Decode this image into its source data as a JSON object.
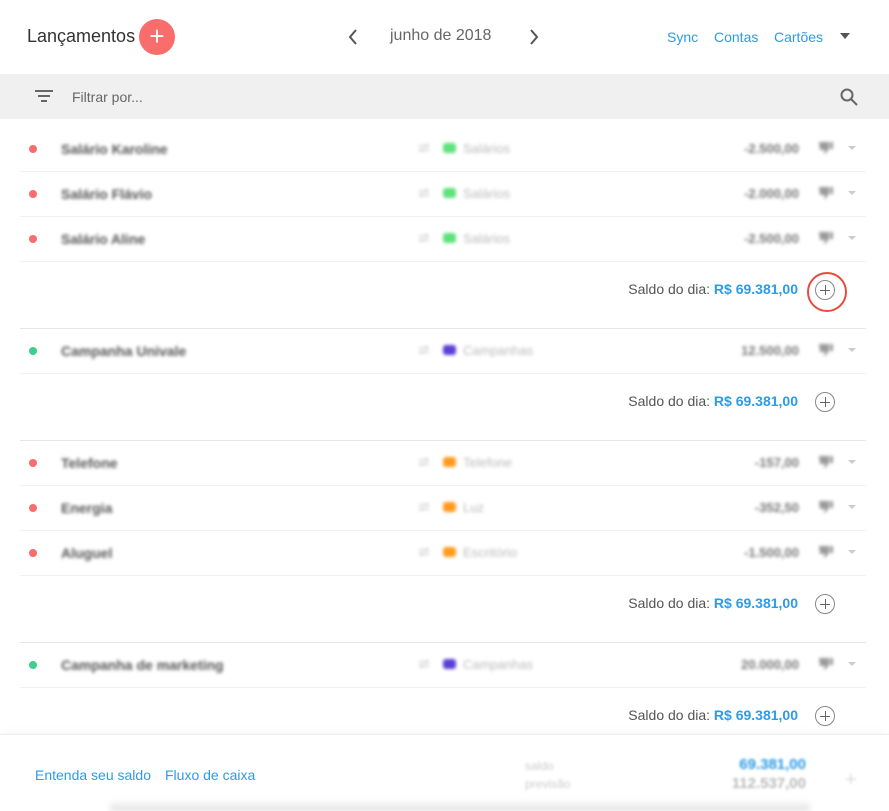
{
  "header": {
    "title": "Lançamentos",
    "add_label": "+",
    "month": "junho de 2018",
    "links": {
      "sync": "Sync",
      "contas": "Contas",
      "cartoes": "Cartões"
    }
  },
  "filter": {
    "placeholder": "Filtrar por..."
  },
  "groups": [
    {
      "items": [
        {
          "name": "Salário Karoline",
          "category": "Salários",
          "category_color": "#5ee27a",
          "value": "-2.500,00",
          "status_color": "#f96d6d"
        },
        {
          "name": "Salário Flávio",
          "category": "Salários",
          "category_color": "#5ee27a",
          "value": "-2.000,00",
          "status_color": "#f96d6d"
        },
        {
          "name": "Salário Aline",
          "category": "Salários",
          "category_color": "#5ee27a",
          "value": "-2.500,00",
          "status_color": "#f96d6d"
        }
      ],
      "saldo_label": "Saldo do dia:",
      "saldo_value": "R$ 69.381,00"
    },
    {
      "items": [
        {
          "name": "Campanha Univale",
          "category": "Campanhas",
          "category_color": "#5b3fd6",
          "value": "12.500,00",
          "status_color": "#3ecf8e"
        }
      ],
      "saldo_label": "Saldo do dia:",
      "saldo_value": "R$ 69.381,00"
    },
    {
      "items": [
        {
          "name": "Telefone",
          "category": "Telefone",
          "category_color": "#ff9a1f",
          "value": "-157,00",
          "status_color": "#f96d6d"
        },
        {
          "name": "Energia",
          "category": "Luz",
          "category_color": "#ff9a1f",
          "value": "-352,50",
          "status_color": "#f96d6d"
        },
        {
          "name": "Aluguel",
          "category": "Escritório",
          "category_color": "#ff9a1f",
          "value": "-1.500,00",
          "status_color": "#f96d6d"
        }
      ],
      "saldo_label": "Saldo do dia:",
      "saldo_value": "R$ 69.381,00"
    },
    {
      "items": [
        {
          "name": "Campanha de marketing",
          "category": "Campanhas",
          "category_color": "#5b3fd6",
          "value": "20.000,00",
          "status_color": "#3ecf8e"
        }
      ],
      "saldo_label": "Saldo do dia:",
      "saldo_value": "R$ 69.381,00"
    }
  ],
  "footer": {
    "link1": "Entenda seu saldo",
    "link2": "Fluxo de caixa",
    "saldo_label": "saldo",
    "saldo_value": "69.381,00",
    "previsao_label": "previsão",
    "previsao_value": "112.537,00",
    "plus": "+"
  },
  "colors": {
    "accent": "#2d9be5",
    "brand": "#f96d6d",
    "highlight": "#e74c3c"
  }
}
